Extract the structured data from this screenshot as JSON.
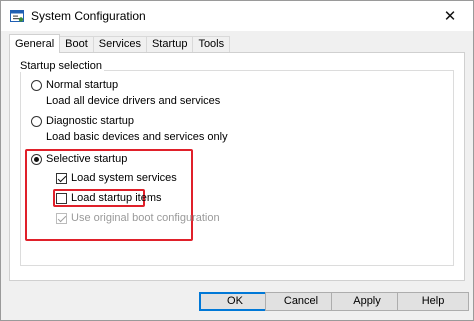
{
  "window": {
    "title": "System Configuration",
    "close_glyph": "✕",
    "icon": "msconfig-icon"
  },
  "tabs": [
    {
      "label": "General",
      "active": true
    },
    {
      "label": "Boot",
      "active": false
    },
    {
      "label": "Services",
      "active": false
    },
    {
      "label": "Startup",
      "active": false
    },
    {
      "label": "Tools",
      "active": false
    }
  ],
  "general": {
    "group_title": "Startup selection",
    "options": {
      "normal": {
        "label": "Normal startup",
        "desc": "Load all device drivers and services",
        "selected": false
      },
      "diagnostic": {
        "label": "Diagnostic startup",
        "desc": "Load basic devices and services only",
        "selected": false
      },
      "selective": {
        "label": "Selective startup",
        "selected": true
      }
    },
    "checks": {
      "system_services": {
        "label": "Load system services",
        "checked": true,
        "enabled": true
      },
      "startup_items": {
        "label": "Load startup items",
        "checked": false,
        "enabled": true
      },
      "boot_config": {
        "label": "Use original boot configuration",
        "checked": true,
        "enabled": false
      }
    }
  },
  "buttons": {
    "ok": "OK",
    "cancel": "Cancel",
    "apply": "Apply",
    "help": "Help"
  },
  "highlight_color": "#e0202a"
}
